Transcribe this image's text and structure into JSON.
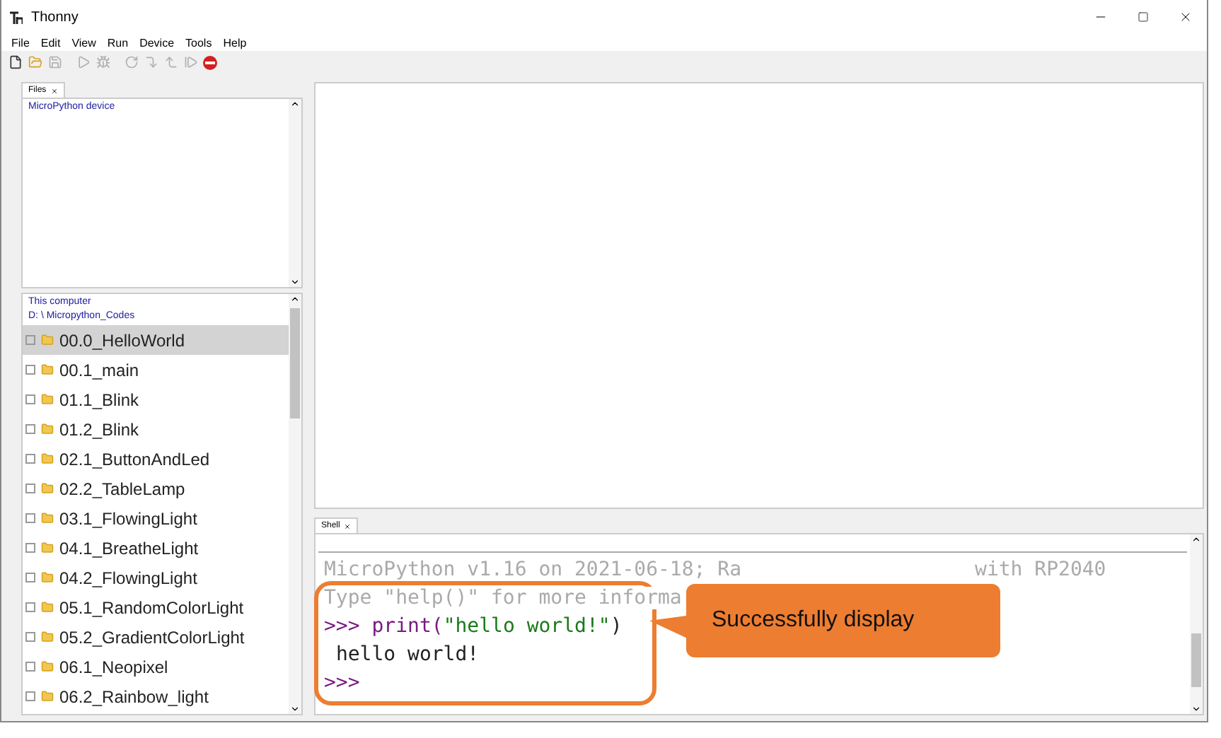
{
  "window": {
    "title": "Thonny"
  },
  "menu": [
    "File",
    "Edit",
    "View",
    "Run",
    "Device",
    "Tools",
    "Help"
  ],
  "toolbar": [
    {
      "kind": "new",
      "disabled": false
    },
    {
      "kind": "open",
      "disabled": false
    },
    {
      "kind": "save",
      "disabled": true
    },
    {
      "kind": "run",
      "disabled": true
    },
    {
      "kind": "debug",
      "disabled": true
    },
    {
      "kind": "step-over",
      "disabled": true
    },
    {
      "kind": "step-into",
      "disabled": true
    },
    {
      "kind": "step-out",
      "disabled": true
    },
    {
      "kind": "resume",
      "disabled": true
    },
    {
      "kind": "stop",
      "disabled": false
    }
  ],
  "files_panel": {
    "tab": "Files",
    "device_title": "MicroPython device",
    "computer_title": "This computer",
    "computer_path": "D: \\ Micropython_Codes",
    "items": [
      {
        "name": "00.0_HelloWorld",
        "selected": true
      },
      {
        "name": "00.1_main",
        "selected": false
      },
      {
        "name": "01.1_Blink",
        "selected": false
      },
      {
        "name": "01.2_Blink",
        "selected": false
      },
      {
        "name": "02.1_ButtonAndLed",
        "selected": false
      },
      {
        "name": "02.2_TableLamp",
        "selected": false
      },
      {
        "name": "03.1_FlowingLight",
        "selected": false
      },
      {
        "name": "04.1_BreatheLight",
        "selected": false
      },
      {
        "name": "04.2_FlowingLight",
        "selected": false
      },
      {
        "name": "05.1_RandomColorLight",
        "selected": false
      },
      {
        "name": "05.2_GradientColorLight",
        "selected": false
      },
      {
        "name": "06.1_Neopixel",
        "selected": false
      },
      {
        "name": "06.2_Rainbow_light",
        "selected": false
      }
    ]
  },
  "shell": {
    "tab": "Shell",
    "banner": "MicroPython v1.16 on 2021-06-18; Ra",
    "banner_tail": "with RP2040",
    "help_line": "Type \"help()\" for more informa",
    "prompt": ">>>",
    "command_name": "print(",
    "command_string": "\"hello world!\"",
    "command_close": ")",
    "output": "hello world!",
    "next_prompt": ">>>"
  },
  "callout": {
    "text": "Successfully display"
  }
}
